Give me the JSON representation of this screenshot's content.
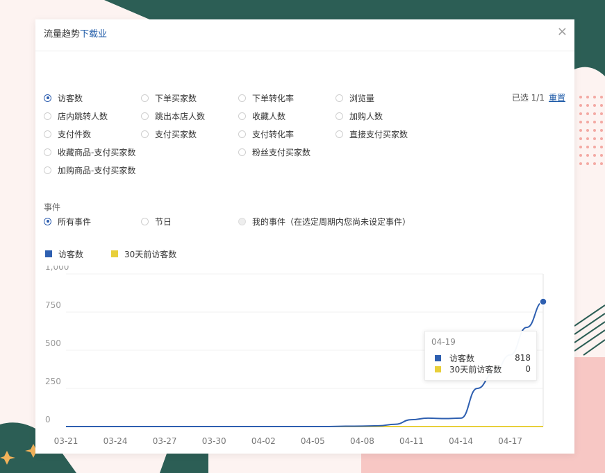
{
  "dialog": {
    "title": "流量趋势",
    "download_label": "下载业",
    "close_glyph": "×"
  },
  "metrics": {
    "selected_label": "已选 1/1",
    "reset_label": "重置",
    "options": [
      {
        "label": "访客数",
        "checked": true
      },
      {
        "label": "下单买家数",
        "checked": false
      },
      {
        "label": "下单转化率",
        "checked": false
      },
      {
        "label": "浏览量",
        "checked": false
      },
      {
        "label": "店内跳转人数",
        "checked": false
      },
      {
        "label": "跳出本店人数",
        "checked": false
      },
      {
        "label": "收藏人数",
        "checked": false
      },
      {
        "label": "加购人数",
        "checked": false
      },
      {
        "label": "支付件数",
        "checked": false
      },
      {
        "label": "支付买家数",
        "checked": false
      },
      {
        "label": "支付转化率",
        "checked": false
      },
      {
        "label": "直接支付买家数",
        "checked": false
      },
      {
        "label": "收藏商品-支付买家数",
        "checked": false
      },
      {
        "label": "粉丝支付买家数",
        "checked": false
      },
      {
        "label": "加购商品-支付买家数",
        "checked": false
      }
    ]
  },
  "events": {
    "section_label": "事件",
    "options": [
      {
        "label": "所有事件",
        "checked": true
      },
      {
        "label": "节日",
        "checked": false
      },
      {
        "label": "我的事件（在选定周期内您尚未设定事件）",
        "checked": false,
        "disabled": true
      }
    ]
  },
  "legend": [
    {
      "label": "访客数",
      "color": "#2e5fb0"
    },
    {
      "label": "30天前访客数",
      "color": "#e8cf3a"
    }
  ],
  "tooltip": {
    "date": "04-19",
    "rows": [
      {
        "label": "访客数",
        "value": "818",
        "color": "#2e5fb0"
      },
      {
        "label": "30天前访客数",
        "value": "0",
        "color": "#e8cf3a"
      }
    ]
  },
  "chart_data": {
    "type": "line",
    "title": "",
    "xlabel": "",
    "ylabel": "",
    "ylim": [
      0,
      1000
    ],
    "y_ticks": [
      "1,000",
      "750",
      "500",
      "250",
      "0"
    ],
    "y_tick_values": [
      1000,
      750,
      500,
      250,
      0
    ],
    "x": [
      "03-21",
      "03-22",
      "03-23",
      "03-24",
      "03-25",
      "03-26",
      "03-27",
      "03-28",
      "03-29",
      "03-30",
      "03-31",
      "04-01",
      "04-02",
      "04-03",
      "04-04",
      "04-05",
      "04-06",
      "04-07",
      "04-08",
      "04-09",
      "04-10",
      "04-11",
      "04-12",
      "04-13",
      "04-14",
      "04-15",
      "04-16",
      "04-17",
      "04-18",
      "04-19"
    ],
    "x_tick_labels": [
      "03-21",
      "03-24",
      "03-27",
      "03-30",
      "04-02",
      "04-05",
      "04-08",
      "04-11",
      "04-14",
      "04-17"
    ],
    "x_tick_index": [
      0,
      3,
      6,
      9,
      12,
      15,
      18,
      21,
      24,
      27
    ],
    "grid": true,
    "legend_position": "top-left",
    "series": [
      {
        "name": "访客数",
        "color": "#2e5fb0",
        "values": [
          0,
          0,
          0,
          0,
          0,
          0,
          0,
          0,
          0,
          0,
          0,
          0,
          0,
          0,
          0,
          0,
          0,
          2,
          3,
          5,
          15,
          45,
          55,
          52,
          55,
          250,
          350,
          470,
          650,
          818
        ]
      },
      {
        "name": "30天前访客数",
        "color": "#e8cf3a",
        "values": [
          0,
          0,
          0,
          0,
          0,
          0,
          0,
          0,
          0,
          0,
          0,
          0,
          0,
          0,
          0,
          0,
          0,
          0,
          0,
          0,
          0,
          0,
          0,
          0,
          0,
          0,
          0,
          0,
          0,
          0
        ]
      }
    ],
    "highlight_index": 29
  }
}
